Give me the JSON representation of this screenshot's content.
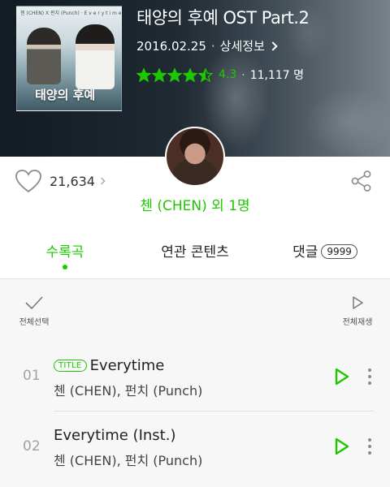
{
  "album": {
    "title": "태양의 후예 OST Part.2",
    "release_date": "2016.02.25",
    "separator": "·",
    "detail_label": "상세정보",
    "rating": "4.3",
    "rating_count": "11,117 명",
    "rating_stars": 4.5,
    "cover_text_top": "첸 (CHEN) X 펀치 (Punch)  ·  E v e r y t i m e",
    "cover_logo": "태양의 후예"
  },
  "actions": {
    "like_count": "21,634"
  },
  "artist": {
    "name": "첸 (CHEN) 외 1명"
  },
  "tabs": [
    {
      "label": "수록곡"
    },
    {
      "label": "연관 콘텐츠"
    },
    {
      "label": "댓글",
      "badge": "9999"
    }
  ],
  "list": {
    "select_all_label": "전체선택",
    "play_all_label": "전체재생",
    "tracks": [
      {
        "number": "01",
        "badge": "TITLE",
        "title": "Everytime",
        "artist": "첸 (CHEN), 펀치 (Punch)"
      },
      {
        "number": "02",
        "title": "Everytime (Inst.)",
        "artist": "첸 (CHEN), 펀치 (Punch)"
      }
    ]
  },
  "colors": {
    "accent": "#1ec800",
    "muted_number": "#a2a2a2",
    "list_background": "#f7f7f7"
  },
  "icons": {
    "rating": "star-icon",
    "like": "heart-outline-icon",
    "share": "share-icon",
    "select_all": "check-icon",
    "play_all": "play-outline-icon",
    "track_play": "play-icon",
    "track_more": "more-vertical-icon"
  }
}
